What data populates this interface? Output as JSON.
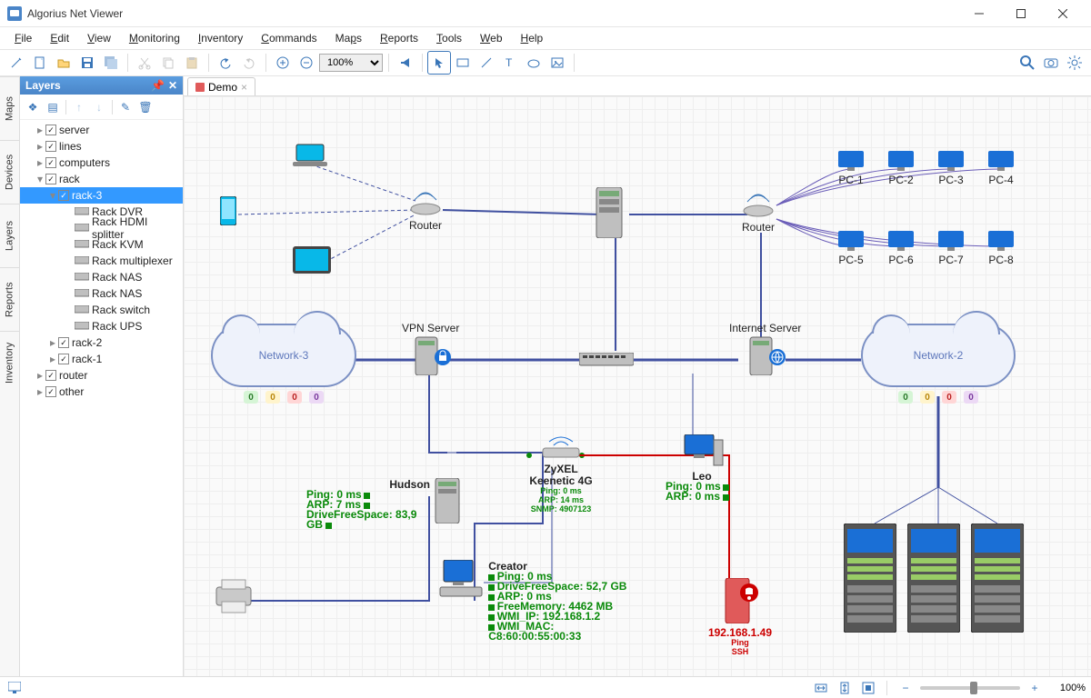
{
  "title": "Algorius Net Viewer",
  "menu": [
    "File",
    "Edit",
    "View",
    "Monitoring",
    "Inventory",
    "Commands",
    "Maps",
    "Reports",
    "Tools",
    "Web",
    "Help"
  ],
  "toolbar": {
    "zoom": "100%"
  },
  "sidetabs": [
    "Maps",
    "Devices",
    "Layers",
    "Reports",
    "Inventory"
  ],
  "layers": {
    "title": "Layers",
    "toolbar": [
      "layers-icon",
      "layers-alt-icon",
      "up-icon",
      "down-icon",
      "edit-icon",
      "delete-icon"
    ],
    "items": [
      {
        "lvl": 1,
        "tw": "▸",
        "cb": true,
        "label": "server"
      },
      {
        "lvl": 1,
        "tw": "▸",
        "cb": true,
        "label": "lines"
      },
      {
        "lvl": 1,
        "tw": "▸",
        "cb": true,
        "label": "computers"
      },
      {
        "lvl": 1,
        "tw": "▾",
        "cb": true,
        "label": "rack"
      },
      {
        "lvl": 2,
        "tw": "▾",
        "cb": true,
        "label": "rack-3",
        "selected": true
      },
      {
        "lvl": 3,
        "tw": "",
        "cb": false,
        "icon": "dvr",
        "label": "Rack DVR"
      },
      {
        "lvl": 3,
        "tw": "",
        "cb": false,
        "icon": "hdmi",
        "label": "Rack HDMI splitter"
      },
      {
        "lvl": 3,
        "tw": "",
        "cb": false,
        "icon": "kvm",
        "label": "Rack KVM"
      },
      {
        "lvl": 3,
        "tw": "",
        "cb": false,
        "icon": "mux",
        "label": "Rack multiplexer"
      },
      {
        "lvl": 3,
        "tw": "",
        "cb": false,
        "icon": "nas",
        "label": "Rack NAS"
      },
      {
        "lvl": 3,
        "tw": "",
        "cb": false,
        "icon": "nas",
        "label": "Rack NAS"
      },
      {
        "lvl": 3,
        "tw": "",
        "cb": false,
        "icon": "switch",
        "label": "Rack switch"
      },
      {
        "lvl": 3,
        "tw": "",
        "cb": false,
        "icon": "ups",
        "label": "Rack UPS"
      },
      {
        "lvl": 2,
        "tw": "▸",
        "cb": true,
        "label": "rack-2"
      },
      {
        "lvl": 2,
        "tw": "▸",
        "cb": true,
        "label": "rack-1"
      },
      {
        "lvl": 1,
        "tw": "▸",
        "cb": true,
        "label": "router"
      },
      {
        "lvl": 1,
        "tw": "▸",
        "cb": true,
        "label": "other"
      }
    ]
  },
  "tab": {
    "title": "Demo"
  },
  "nodes": {
    "router1": "Router",
    "router2": "Router",
    "pc1": "PC-1",
    "pc2": "PC-2",
    "pc3": "PC-3",
    "pc4": "PC-4",
    "pc5": "PC-5",
    "pc6": "PC-6",
    "pc7": "PC-7",
    "pc8": "PC-8",
    "vpn": "VPN Server",
    "internet": "Internet Server",
    "net3": "Network-3",
    "net2": "Network-2",
    "hudson": {
      "name": "Hudson",
      "s1": "Ping: 0 ms",
      "s2": "ARP: 7 ms",
      "s3": "DriveFreeSpace: 83,9 GB"
    },
    "zyxel": {
      "name": "ZyXEL",
      "sub": "Keenetic 4G",
      "s1": "Ping: 0 ms",
      "s2": "ARP: 14 ms",
      "s3": "SNMP: 4907123"
    },
    "leo": {
      "name": "Leo",
      "s1": "Ping: 0 ms",
      "s2": "ARP: 0 ms"
    },
    "creator": {
      "name": "Creator",
      "s1": "Ping: 0 ms",
      "s2": "DriveFreeSpace: 52,7 GB",
      "s3": "ARP: 0 ms",
      "s4": "FreeMemory: 4462 MB",
      "s5": "WMI_IP: 192.168.1.2",
      "s6": "WMI_MAC: C8:60:00:55:00:33"
    },
    "alert": {
      "ip": "192.168.1.49",
      "s1": "Ping",
      "s2": "SSH"
    },
    "badges": [
      "0",
      "0",
      "0",
      "0"
    ]
  },
  "statusbar": {
    "zoom": "100%"
  }
}
